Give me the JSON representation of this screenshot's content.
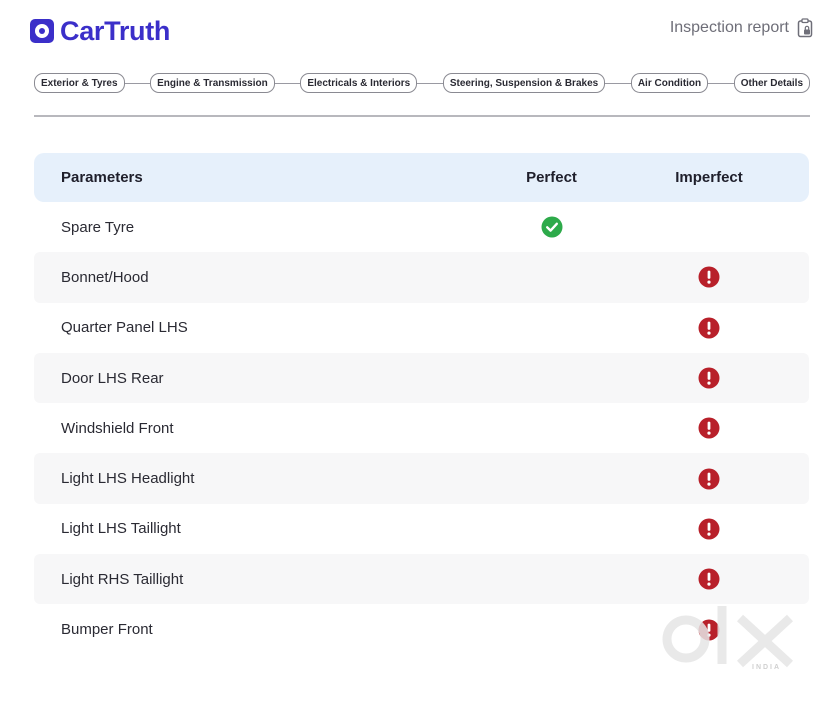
{
  "brand": {
    "name": "CarTruth",
    "color": "#3b2fc9"
  },
  "header": {
    "report_label": "Inspection report",
    "report_icon": "clipboard-lock-icon"
  },
  "steps": [
    {
      "label": "Exterior & Tyres"
    },
    {
      "label": "Engine & Transmission"
    },
    {
      "label": "Electricals & Interiors"
    },
    {
      "label": "Steering, Suspension & Brakes"
    },
    {
      "label": "Air Condition"
    },
    {
      "label": "Other Details"
    }
  ],
  "table": {
    "columns": {
      "parameters": "Parameters",
      "perfect": "Perfect",
      "imperfect": "Imperfect"
    },
    "rows": [
      {
        "parameter": "Spare Tyre",
        "status": "perfect"
      },
      {
        "parameter": "Bonnet/Hood",
        "status": "imperfect"
      },
      {
        "parameter": "Quarter Panel LHS",
        "status": "imperfect"
      },
      {
        "parameter": "Door LHS Rear",
        "status": "imperfect"
      },
      {
        "parameter": "Windshield Front",
        "status": "imperfect"
      },
      {
        "parameter": "Light LHS Headlight",
        "status": "imperfect"
      },
      {
        "parameter": "Light LHS Taillight",
        "status": "imperfect"
      },
      {
        "parameter": "Light RHS Taillight",
        "status": "imperfect"
      },
      {
        "parameter": "Bumper Front",
        "status": "imperfect"
      }
    ]
  },
  "icons": {
    "perfect": "check-circle-icon",
    "imperfect": "exclamation-circle-icon"
  },
  "colors": {
    "brand": "#3b2fc9",
    "header_bg": "#e6f0fb",
    "row_alt": "#f7f7f8",
    "perfect_green": "#2daa4a",
    "imperfect_red": "#b8202a"
  },
  "watermark": {
    "text": "olx",
    "sub": "INDIA"
  }
}
